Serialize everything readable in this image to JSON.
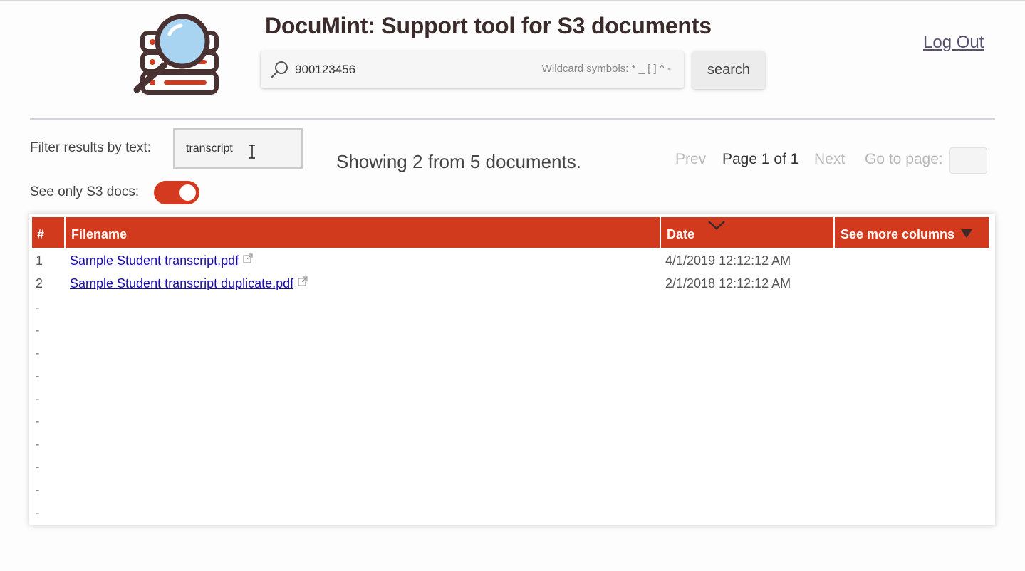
{
  "header": {
    "title": "DocuMint: Support tool for S3 documents",
    "logout_label": "Log Out",
    "logo_icon": "documents-magnifier-logo-icon"
  },
  "search": {
    "value": "900123456",
    "hint": "Wildcard symbols: * _ [ ] ^ -",
    "button_label": "search"
  },
  "filters": {
    "text_label": "Filter results by text:",
    "text_value": "transcript",
    "toggle_label": "See only S3 docs:",
    "toggle_on": true
  },
  "results": {
    "summary": "Showing 2 from 5 documents."
  },
  "pager": {
    "prev_label": "Prev",
    "page_label": "Page 1 of 1",
    "next_label": "Next",
    "goto_label": "Go to page:"
  },
  "table": {
    "headers": {
      "num": "#",
      "filename": "Filename",
      "date": "Date",
      "more": "See more columns"
    },
    "rows": [
      {
        "num": "1",
        "filename": "Sample Student transcript.pdf",
        "date": "4/1/2019 12:12:12 AM"
      },
      {
        "num": "2",
        "filename": "Sample Student transcript duplicate.pdf",
        "date": "2/1/2018 12:12:12 AM"
      }
    ],
    "empty_marker": "-",
    "empty_rows": 10
  },
  "colors": {
    "accent": "#d13a1c",
    "link": "#1a0dab",
    "title": "#3b2b2b"
  }
}
